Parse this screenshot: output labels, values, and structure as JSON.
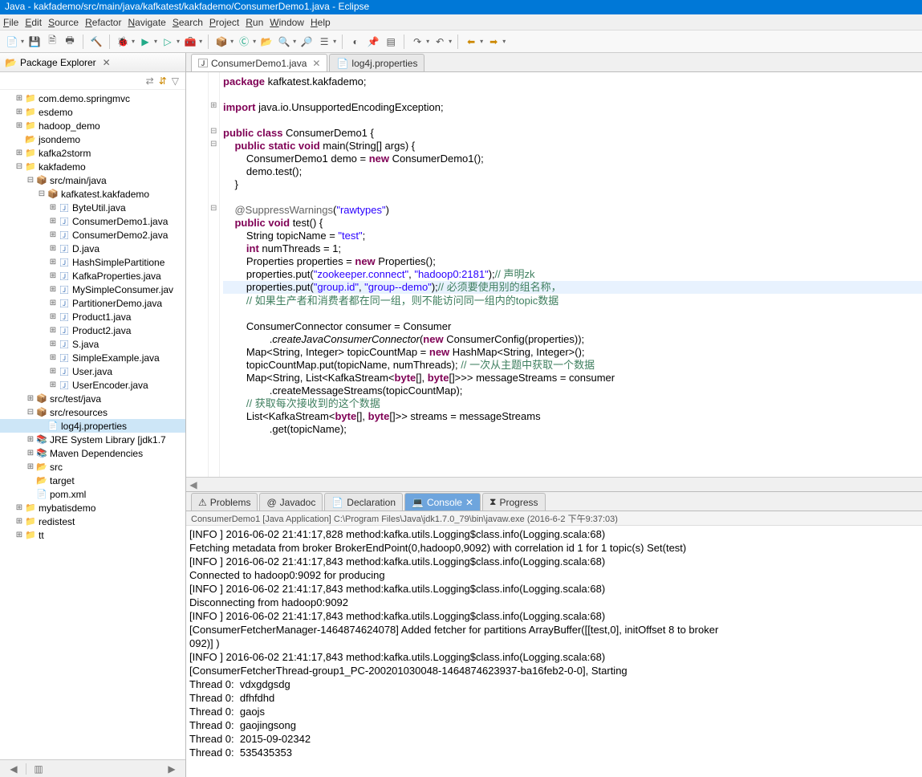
{
  "title": "Java - kakfademo/src/main/java/kafkatest/kakfademo/ConsumerDemo1.java - Eclipse",
  "menu": [
    "File",
    "Edit",
    "Source",
    "Refactor",
    "Navigate",
    "Search",
    "Project",
    "Run",
    "Window",
    "Help"
  ],
  "pkg_explorer": {
    "title": "Package Explorer"
  },
  "tree": [
    {
      "d": 0,
      "tw": "+",
      "ic": "prj",
      "g": "📁",
      "t": "com.demo.springmvc"
    },
    {
      "d": 0,
      "tw": "+",
      "ic": "prj",
      "g": "📁",
      "t": "esdemo"
    },
    {
      "d": 0,
      "tw": "+",
      "ic": "prj",
      "g": "📁",
      "t": "hadoop_demo"
    },
    {
      "d": 0,
      "tw": " ",
      "ic": "fold",
      "g": "📂",
      "t": "jsondemo"
    },
    {
      "d": 0,
      "tw": "+",
      "ic": "prj",
      "g": "📁",
      "t": "kafka2storm"
    },
    {
      "d": 0,
      "tw": "-",
      "ic": "prj",
      "g": "📁",
      "t": "kakfademo"
    },
    {
      "d": 1,
      "tw": "-",
      "ic": "src",
      "g": "📦",
      "t": "src/main/java"
    },
    {
      "d": 2,
      "tw": "-",
      "ic": "pkg",
      "g": "📦",
      "t": "kafkatest.kakfademo"
    },
    {
      "d": 3,
      "tw": "+",
      "ic": "java",
      "g": "🄹",
      "t": "ByteUtil.java"
    },
    {
      "d": 3,
      "tw": "+",
      "ic": "java",
      "g": "🄹",
      "t": "ConsumerDemo1.java"
    },
    {
      "d": 3,
      "tw": "+",
      "ic": "java",
      "g": "🄹",
      "t": "ConsumerDemo2.java"
    },
    {
      "d": 3,
      "tw": "+",
      "ic": "java",
      "g": "🄹",
      "t": "D.java"
    },
    {
      "d": 3,
      "tw": "+",
      "ic": "java",
      "g": "🄹",
      "t": "HashSimplePartitione"
    },
    {
      "d": 3,
      "tw": "+",
      "ic": "java",
      "g": "🄹",
      "t": "KafkaProperties.java"
    },
    {
      "d": 3,
      "tw": "+",
      "ic": "java",
      "g": "🄹",
      "t": "MySimpleConsumer.jav"
    },
    {
      "d": 3,
      "tw": "+",
      "ic": "java",
      "g": "🄹",
      "t": "PartitionerDemo.java"
    },
    {
      "d": 3,
      "tw": "+",
      "ic": "java",
      "g": "🄹",
      "t": "Product1.java"
    },
    {
      "d": 3,
      "tw": "+",
      "ic": "java",
      "g": "🄹",
      "t": "Product2.java"
    },
    {
      "d": 3,
      "tw": "+",
      "ic": "java",
      "g": "🄹",
      "t": "S.java"
    },
    {
      "d": 3,
      "tw": "+",
      "ic": "java",
      "g": "🄹",
      "t": "SimpleExample.java"
    },
    {
      "d": 3,
      "tw": "+",
      "ic": "java",
      "g": "🄹",
      "t": "User.java"
    },
    {
      "d": 3,
      "tw": "+",
      "ic": "java",
      "g": "🄹",
      "t": "UserEncoder.java"
    },
    {
      "d": 1,
      "tw": "+",
      "ic": "src",
      "g": "📦",
      "t": "src/test/java"
    },
    {
      "d": 1,
      "tw": "-",
      "ic": "src",
      "g": "📦",
      "t": "src/resources"
    },
    {
      "d": 2,
      "tw": " ",
      "ic": "file",
      "g": "📄",
      "t": "log4j.properties",
      "sel": true
    },
    {
      "d": 1,
      "tw": "+",
      "ic": "jre",
      "g": "📚",
      "t": "JRE System Library [jdk1.7"
    },
    {
      "d": 1,
      "tw": "+",
      "ic": "jre",
      "g": "📚",
      "t": "Maven Dependencies"
    },
    {
      "d": 1,
      "tw": "+",
      "ic": "fold",
      "g": "📂",
      "t": "src"
    },
    {
      "d": 1,
      "tw": " ",
      "ic": "fold",
      "g": "📂",
      "t": "target"
    },
    {
      "d": 1,
      "tw": " ",
      "ic": "file",
      "g": "📄",
      "t": "pom.xml"
    },
    {
      "d": 0,
      "tw": "+",
      "ic": "prj",
      "g": "📁",
      "t": "mybatisdemo"
    },
    {
      "d": 0,
      "tw": "+",
      "ic": "prj",
      "g": "📁",
      "t": "redistest"
    },
    {
      "d": 0,
      "tw": "+",
      "ic": "prj",
      "g": "📁",
      "t": "tt"
    }
  ],
  "editor_tabs": [
    {
      "label": "ConsumerDemo1.java",
      "active": true,
      "icon": "🄹"
    },
    {
      "label": "log4j.properties",
      "active": false,
      "icon": "📄"
    }
  ],
  "code_lines": [
    [
      {
        "c": "kw",
        "t": "package"
      },
      {
        "t": " kafkatest.kakfademo;"
      }
    ],
    [],
    [
      {
        "c": "kw",
        "t": "import"
      },
      {
        "t": " java.io.UnsupportedEncodingException;"
      }
    ],
    [],
    [
      {
        "c": "kw",
        "t": "public class"
      },
      {
        "t": " ConsumerDemo1 {"
      }
    ],
    [
      {
        "t": "    "
      },
      {
        "c": "kw",
        "t": "public static void"
      },
      {
        "t": " main(String[] args) {"
      }
    ],
    [
      {
        "t": "        ConsumerDemo1 demo = "
      },
      {
        "c": "kw",
        "t": "new"
      },
      {
        "t": " ConsumerDemo1();"
      }
    ],
    [
      {
        "t": "        demo.test();"
      }
    ],
    [
      {
        "t": "    }"
      }
    ],
    [],
    [
      {
        "t": "    "
      },
      {
        "c": "ann",
        "t": "@SuppressWarnings"
      },
      {
        "t": "("
      },
      {
        "c": "str",
        "t": "\"rawtypes\""
      },
      {
        "t": ")"
      }
    ],
    [
      {
        "t": "    "
      },
      {
        "c": "kw",
        "t": "public void"
      },
      {
        "t": " test() {"
      }
    ],
    [
      {
        "t": "        String topicName = "
      },
      {
        "c": "str",
        "t": "\"test\""
      },
      {
        "t": ";"
      }
    ],
    [
      {
        "t": "        "
      },
      {
        "c": "kw",
        "t": "int"
      },
      {
        "t": " numThreads = 1;"
      }
    ],
    [
      {
        "t": "        Properties properties = "
      },
      {
        "c": "kw",
        "t": "new"
      },
      {
        "t": " Properties();"
      }
    ],
    [
      {
        "t": "        properties.put("
      },
      {
        "c": "str",
        "t": "\"zookeeper.connect\""
      },
      {
        "t": ", "
      },
      {
        "c": "str",
        "t": "\"hadoop0:2181\""
      },
      {
        "t": ");"
      },
      {
        "c": "cmt",
        "t": "// 声明zk"
      }
    ],
    [
      {
        "hl": true,
        "t": "        properties.put("
      },
      {
        "c": "str",
        "t": "\"group.id\""
      },
      {
        "t": ", "
      },
      {
        "c": "str",
        "t": "\"group--demo\""
      },
      {
        "t": ");"
      },
      {
        "c": "cmt",
        "t": "// 必须要使用别的组名称，"
      }
    ],
    [
      {
        "t": "        "
      },
      {
        "c": "cmt",
        "t": "// 如果生产者和消费者都在同一组，则不能访问同一组内的topic数据"
      }
    ],
    [],
    [
      {
        "t": "        ConsumerConnector consumer = Consumer"
      }
    ],
    [
      {
        "t": "                ."
      },
      {
        "c": "",
        "t": "createJavaConsumerConnector",
        "i": true
      },
      {
        "t": "("
      },
      {
        "c": "kw",
        "t": "new"
      },
      {
        "t": " ConsumerConfig(properties));"
      }
    ],
    [
      {
        "t": "        Map<String, Integer> topicCountMap = "
      },
      {
        "c": "kw",
        "t": "new"
      },
      {
        "t": " HashMap<String, Integer>();"
      }
    ],
    [
      {
        "t": "        topicCountMap.put(topicName, numThreads); "
      },
      {
        "c": "cmt",
        "t": "// 一次从主题中获取一个数据"
      }
    ],
    [
      {
        "t": "        Map<String, List<KafkaStream<"
      },
      {
        "c": "kw",
        "t": "byte"
      },
      {
        "t": "[], "
      },
      {
        "c": "kw",
        "t": "byte"
      },
      {
        "t": "[]>>> messageStreams = consumer"
      }
    ],
    [
      {
        "t": "                .createMessageStreams(topicCountMap);"
      }
    ],
    [
      {
        "t": "        "
      },
      {
        "c": "cmt",
        "t": "// 获取每次接收到的这个数据"
      }
    ],
    [
      {
        "t": "        List<KafkaStream<"
      },
      {
        "c": "kw",
        "t": "byte"
      },
      {
        "t": "[], "
      },
      {
        "c": "kw",
        "t": "byte"
      },
      {
        "t": "[]>> streams = messageStreams"
      }
    ],
    [
      {
        "t": "                .get(topicName);"
      }
    ]
  ],
  "fold_marks": [
    {
      "line": 2,
      "g": "⊞"
    },
    {
      "line": 4,
      "g": "⊟"
    },
    {
      "line": 5,
      "g": "⊟"
    },
    {
      "line": 10,
      "g": "⊟"
    }
  ],
  "bottom_tabs": [
    {
      "label": "Problems",
      "icon": "⚠"
    },
    {
      "label": "Javadoc",
      "icon": "@"
    },
    {
      "label": "Declaration",
      "icon": "📄"
    },
    {
      "label": "Console",
      "icon": "💻",
      "active": true
    },
    {
      "label": "Progress",
      "icon": "⧗"
    }
  ],
  "console_header": "ConsumerDemo1 [Java Application] C:\\Program Files\\Java\\jdk1.7.0_79\\bin\\javaw.exe (2016-6-2 下午9:37:03)",
  "console_lines": [
    "[INFO ] 2016-06-02 21:41:17,828 method:kafka.utils.Logging$class.info(Logging.scala:68)",
    "Fetching metadata from broker BrokerEndPoint(0,hadoop0,9092) with correlation id 1 for 1 topic(s) Set(test)",
    "[INFO ] 2016-06-02 21:41:17,843 method:kafka.utils.Logging$class.info(Logging.scala:68)",
    "Connected to hadoop0:9092 for producing",
    "[INFO ] 2016-06-02 21:41:17,843 method:kafka.utils.Logging$class.info(Logging.scala:68)",
    "Disconnecting from hadoop0:9092",
    "[INFO ] 2016-06-02 21:41:17,843 method:kafka.utils.Logging$class.info(Logging.scala:68)",
    "[ConsumerFetcherManager-1464874624078] Added fetcher for partitions ArrayBuffer([[test,0], initOffset 8 to broker ",
    "092)] )",
    "[INFO ] 2016-06-02 21:41:17,843 method:kafka.utils.Logging$class.info(Logging.scala:68)",
    "[ConsumerFetcherThread-group1_PC-200201030048-1464874623937-ba16feb2-0-0], Starting",
    "Thread 0:  vdxgdgsdg",
    "Thread 0:  dfhfdhd",
    "Thread 0:  gaojs",
    "Thread 0:  gaojingsong",
    "Thread 0:  2015-09-02342",
    "Thread 0:  535435353"
  ]
}
